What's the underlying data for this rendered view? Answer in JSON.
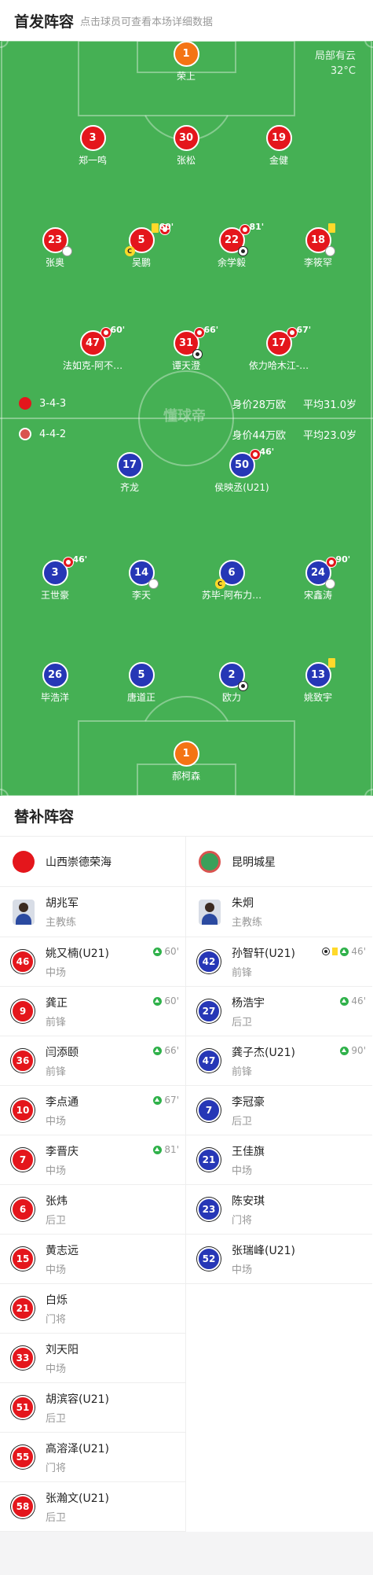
{
  "header": {
    "title": "首发阵容",
    "subtitle": "点击球员可查看本场详细数据"
  },
  "weather": {
    "condition": "局部有云",
    "temperature": "32°C"
  },
  "watermark": "懂球帝",
  "home": {
    "formation": "3-4-3",
    "value": "身价28万欧",
    "avg_age": "平均31.0岁",
    "color": "#e4161c",
    "players": {
      "gk": {
        "num": "1",
        "name": "荣上"
      },
      "d1": {
        "num": "3",
        "name": "郑一鸣"
      },
      "d2": {
        "num": "30",
        "name": "张松"
      },
      "d3": {
        "num": "19",
        "name": "金健"
      },
      "m1": {
        "num": "23",
        "name": "张奥"
      },
      "m2": {
        "num": "5",
        "name": "吴鹏",
        "time": "60'"
      },
      "m3": {
        "num": "22",
        "name": "余学毅",
        "time": "81'"
      },
      "m4": {
        "num": "18",
        "name": "李筱罕"
      },
      "f1": {
        "num": "47",
        "name": "法如克-阿不…",
        "time": "60'"
      },
      "f2": {
        "num": "31",
        "name": "谭天澄",
        "time": "66'"
      },
      "f3": {
        "num": "17",
        "name": "依力哈木江-…",
        "time": "67'"
      }
    }
  },
  "away": {
    "formation": "4-4-2",
    "value": "身价44万欧",
    "avg_age": "平均23.0岁",
    "color": "#2637b6",
    "players": {
      "f1": {
        "num": "17",
        "name": "齐龙"
      },
      "f2": {
        "num": "50",
        "name": "侯映丞(U21)",
        "time": "46'"
      },
      "m1": {
        "num": "3",
        "name": "王世豪",
        "time": "46'"
      },
      "m2": {
        "num": "14",
        "name": "李天"
      },
      "m3": {
        "num": "6",
        "name": "苏毕-阿布力…"
      },
      "m4": {
        "num": "24",
        "name": "宋鑫涛",
        "time": "90'"
      },
      "d1": {
        "num": "26",
        "name": "毕浩洋"
      },
      "d2": {
        "num": "5",
        "name": "唐道正"
      },
      "d3": {
        "num": "2",
        "name": "欧力"
      },
      "d4": {
        "num": "13",
        "name": "姚致宇"
      },
      "gk": {
        "num": "1",
        "name": "郝柯森"
      }
    }
  },
  "subs": {
    "title": "替补阵容",
    "home_team": "山西崇德荣海",
    "away_team": "昆明城星",
    "home_coach": {
      "name": "胡兆军",
      "role": "主教练"
    },
    "away_coach": {
      "name": "朱炯",
      "role": "主教练"
    },
    "home_list": [
      {
        "num": "46",
        "name": "姚又楠(U21)",
        "pos": "中场",
        "time": "60'"
      },
      {
        "num": "9",
        "name": "龚正",
        "pos": "前锋",
        "time": "60'"
      },
      {
        "num": "36",
        "name": "闫添颐",
        "pos": "前锋",
        "time": "66'"
      },
      {
        "num": "10",
        "name": "李点通",
        "pos": "中场",
        "time": "67'"
      },
      {
        "num": "7",
        "name": "李晋庆",
        "pos": "中场",
        "time": "81'"
      },
      {
        "num": "6",
        "name": "张炜",
        "pos": "后卫",
        "time": ""
      },
      {
        "num": "15",
        "name": "黄志远",
        "pos": "中场",
        "time": ""
      },
      {
        "num": "21",
        "name": "白烁",
        "pos": "门将",
        "time": ""
      },
      {
        "num": "33",
        "name": "刘天阳",
        "pos": "中场",
        "time": ""
      },
      {
        "num": "51",
        "name": "胡滨容(U21)",
        "pos": "后卫",
        "time": ""
      },
      {
        "num": "55",
        "name": "高溶泽(U21)",
        "pos": "门将",
        "time": ""
      },
      {
        "num": "58",
        "name": "张瀚文(U21)",
        "pos": "后卫",
        "time": ""
      }
    ],
    "away_list": [
      {
        "num": "42",
        "name": "孙智轩(U21)",
        "pos": "前锋",
        "time": "46'"
      },
      {
        "num": "27",
        "name": "杨浩宇",
        "pos": "后卫",
        "time": "46'"
      },
      {
        "num": "47",
        "name": "龚子杰(U21)",
        "pos": "前锋",
        "time": "90'"
      },
      {
        "num": "7",
        "name": "李冠豪",
        "pos": "后卫",
        "time": ""
      },
      {
        "num": "21",
        "name": "王佳旗",
        "pos": "中场",
        "time": ""
      },
      {
        "num": "23",
        "name": "陈安琪",
        "pos": "门将",
        "time": ""
      },
      {
        "num": "52",
        "name": "张瑞峰(U21)",
        "pos": "中场",
        "time": ""
      }
    ]
  }
}
